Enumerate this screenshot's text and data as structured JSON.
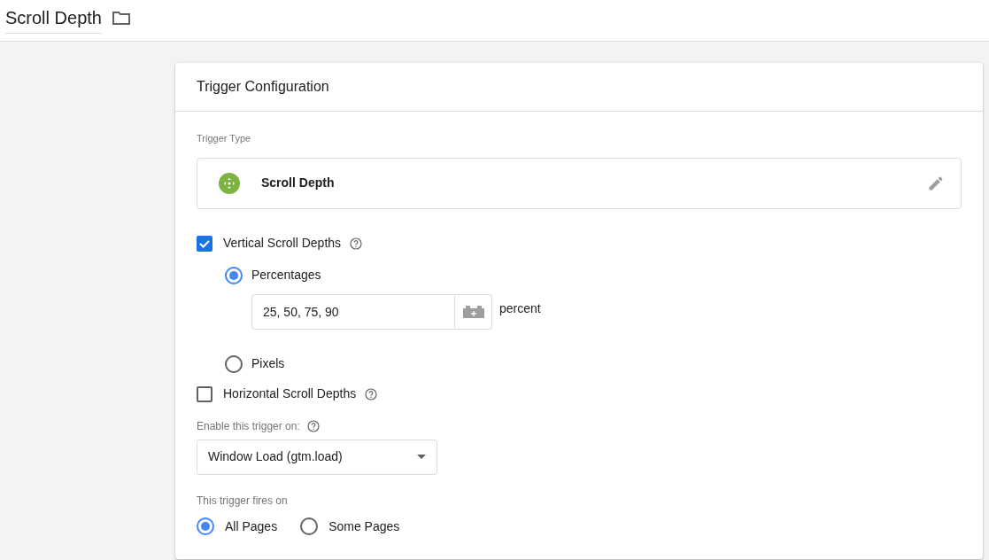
{
  "header": {
    "title": "Scroll Depth"
  },
  "card": {
    "title": "Trigger Configuration",
    "trigger_type": {
      "label": "Trigger Type",
      "name": "Scroll Depth"
    },
    "vertical": {
      "label": "Vertical Scroll Depths",
      "checked": true,
      "options": [
        {
          "label": "Percentages",
          "selected": true,
          "kind": "field",
          "value": "25, 50, 75, 90",
          "unit": "percent"
        },
        {
          "label": "Pixels",
          "selected": false,
          "kind": "plain"
        }
      ]
    },
    "horizontal": {
      "label": "Horizontal Scroll Depths",
      "checked": false
    },
    "enable": {
      "label": "Enable this trigger on:",
      "value": "Window Load (gtm.load)"
    },
    "fires": {
      "label": "This trigger fires on",
      "options": [
        {
          "label": "All Pages",
          "selected": true
        },
        {
          "label": "Some Pages",
          "selected": false
        }
      ]
    }
  }
}
